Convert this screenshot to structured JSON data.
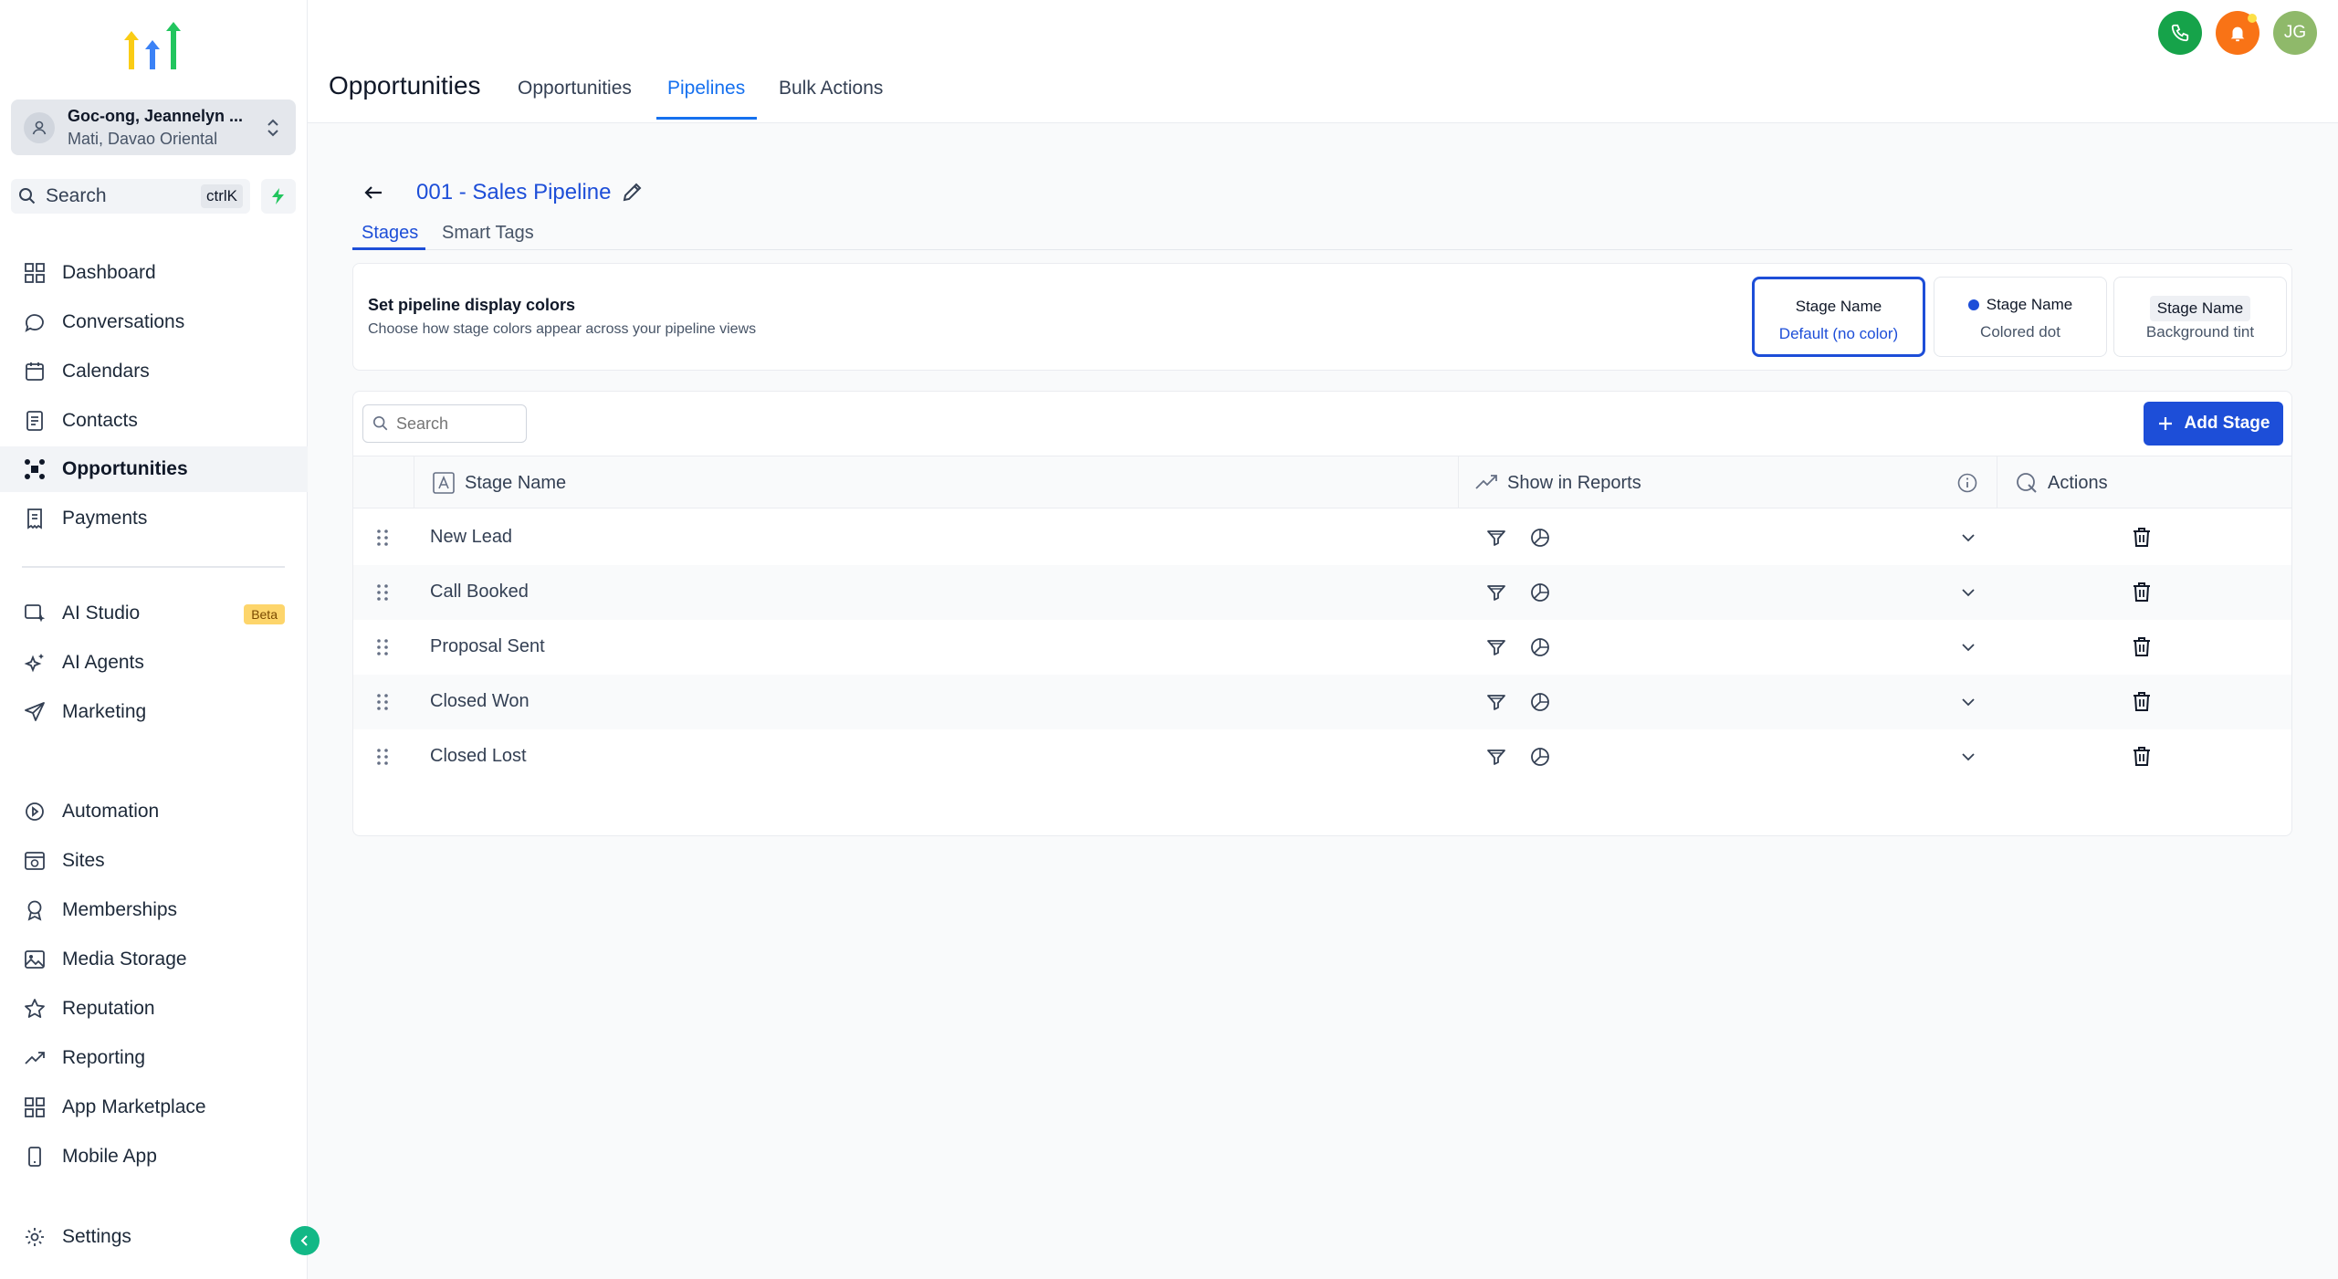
{
  "sidebar": {
    "account": {
      "name": "Goc-ong, Jeannelyn ...",
      "location": "Mati, Davao Oriental"
    },
    "search": {
      "label": "Search",
      "shortcut": "ctrlK"
    },
    "items": [
      {
        "label": "Dashboard",
        "icon": "dashboard-icon"
      },
      {
        "label": "Conversations",
        "icon": "chat-icon"
      },
      {
        "label": "Calendars",
        "icon": "calendar-icon"
      },
      {
        "label": "Contacts",
        "icon": "contacts-icon"
      },
      {
        "label": "Opportunities",
        "icon": "opportunities-icon",
        "active": true
      },
      {
        "label": "Payments",
        "icon": "payments-icon"
      },
      {
        "label": "AI Studio",
        "icon": "ai-studio-icon",
        "badge": "Beta"
      },
      {
        "label": "AI Agents",
        "icon": "sparkle-icon"
      },
      {
        "label": "Marketing",
        "icon": "send-icon"
      },
      {
        "label": "Automation",
        "icon": "automation-icon"
      },
      {
        "label": "Sites",
        "icon": "sites-icon"
      },
      {
        "label": "Memberships",
        "icon": "badge-icon"
      },
      {
        "label": "Media Storage",
        "icon": "image-icon"
      },
      {
        "label": "Reputation",
        "icon": "star-icon"
      },
      {
        "label": "Reporting",
        "icon": "trend-icon"
      },
      {
        "label": "App Marketplace",
        "icon": "grid-icon"
      },
      {
        "label": "Mobile App",
        "icon": "phone-icon"
      },
      {
        "label": "Settings",
        "icon": "gear-icon"
      }
    ]
  },
  "header": {
    "title": "Opportunities",
    "tabs": [
      {
        "label": "Opportunities"
      },
      {
        "label": "Pipelines",
        "active": true
      },
      {
        "label": "Bulk Actions"
      }
    ],
    "avatar_initials": "JG"
  },
  "pipeline": {
    "title": "001 - Sales Pipeline",
    "tabs": [
      {
        "label": "Stages",
        "active": true
      },
      {
        "label": "Smart Tags"
      }
    ]
  },
  "display_colors": {
    "title": "Set pipeline display colors",
    "subtitle": "Choose how stage colors appear across your pipeline views",
    "options": [
      {
        "name": "Stage Name",
        "desc": "Default (no color)",
        "selected": true
      },
      {
        "name": "Stage Name",
        "desc": "Colored dot"
      },
      {
        "name": "Stage Name",
        "desc": "Background tint"
      }
    ]
  },
  "stages": {
    "search_placeholder": "Search",
    "add_button": "Add Stage",
    "columns": {
      "name": "Stage Name",
      "reports": "Show in Reports",
      "actions": "Actions"
    },
    "rows": [
      {
        "name": "New Lead"
      },
      {
        "name": "Call Booked"
      },
      {
        "name": "Proposal Sent"
      },
      {
        "name": "Closed Won"
      },
      {
        "name": "Closed Lost"
      }
    ]
  },
  "colors": {
    "accent": "#1d4ed8",
    "tab_blue": "#1570ef",
    "phone_green": "#16a34a",
    "bell_orange": "#f97316",
    "avatar_green": "#8fb96a"
  }
}
